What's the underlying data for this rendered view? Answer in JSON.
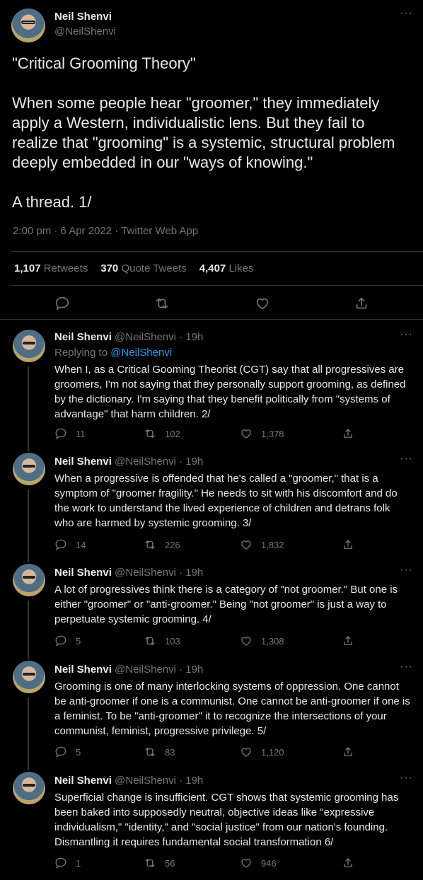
{
  "main_tweet": {
    "name": "Neil Shenvi",
    "handle": "@NeilShenvi",
    "text": "\"Critical Grooming Theory\"\n\nWhen some people hear \"groomer,\" they immediately apply a Western, individualistic lens. But they fail to realize that \"grooming\" is a systemic, structural problem deeply embedded in our \"ways of knowing.\"\n\nA thread. 1/",
    "meta": "2:00 pm · 6 Apr 2022 · Twitter Web App",
    "retweets_count": "1,107",
    "retweets_label": "Retweets",
    "quotes_count": "370",
    "quotes_label": "Quote Tweets",
    "likes_count": "4,407",
    "likes_label": "Likes",
    "icons": [
      "reply-icon",
      "retweet-icon",
      "like-icon",
      "share-icon"
    ]
  },
  "replies": [
    {
      "name": "Neil Shenvi",
      "handle_time": "@NeilShenvi · 19h",
      "replying_prefix": "Replying to ",
      "replying_to": "@NeilShenvi",
      "text": "When I, as a Critical Gooming Theorist (CGT) say that all progressives are groomers, I'm not saying that they personally support grooming, as defined by the dictionary. I'm saying that they benefit politically from \"systems of advantage\" that harm children. 2/",
      "replies": "11",
      "retweets": "102",
      "likes": "1,378"
    },
    {
      "name": "Neil Shenvi",
      "handle_time": "@NeilShenvi · 19h",
      "text": "When a progressive is offended that he's called a \"groomer,\" that is a symptom of \"groomer fragility.\" He needs to sit with his discomfort and do the work to understand the lived experience of children and detrans folk who are harmed by systemic grooming. 3/",
      "replies": "14",
      "retweets": "226",
      "likes": "1,832"
    },
    {
      "name": "Neil Shenvi",
      "handle_time": "@NeilShenvi · 19h",
      "text": "A lot of progressives think there is a category of \"not groomer.\" But one is either \"groomer\" or \"anti-groomer.\" Being \"not groomer\" is just a way to perpetuate systemic grooming. 4/",
      "replies": "5",
      "retweets": "103",
      "likes": "1,308"
    },
    {
      "name": "Neil Shenvi",
      "handle_time": "@NeilShenvi · 19h",
      "text": "Grooming is one of many interlocking systems of oppression. One cannot be anti-groomer if one is a communist. One cannot be anti-groomer if one is a feminist. To be \"anti-groomer\" it to recognize the intersections of your communist, feminist, progressive privilege. 5/",
      "replies": "5",
      "retweets": "83",
      "likes": "1,120"
    },
    {
      "name": "Neil Shenvi",
      "handle_time": "@NeilShenvi · 19h",
      "text": "Superficial change is insufficient. CGT shows that systemic grooming has been baked into supposedly neutral, objective ideas like \"expressive individualism,\" \"identity,\" and \"social justice\" from our nation's founding. Dismantling it requires fundamental social transformation 6/",
      "replies": "1",
      "retweets": "56",
      "likes": "946"
    }
  ],
  "more_label": "···",
  "colors": {
    "background": "#000000",
    "text": "#e7e9ea",
    "muted": "#71767b",
    "link": "#1d9bf0",
    "border": "#2f3336"
  }
}
